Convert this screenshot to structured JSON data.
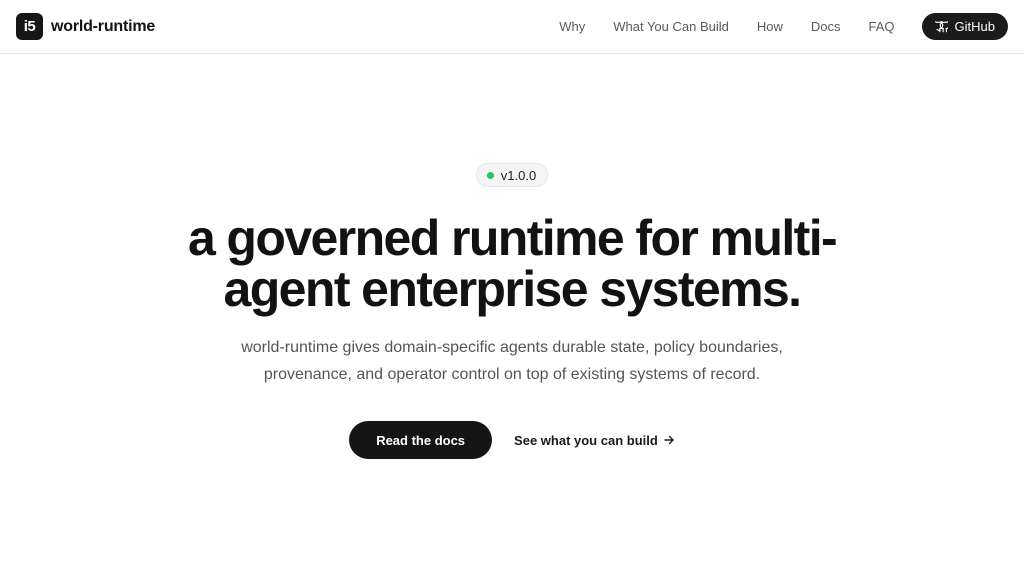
{
  "header": {
    "logo_text": "i5",
    "brand_name": "world-runtime",
    "nav": [
      {
        "label": "Why"
      },
      {
        "label": "What You Can Build"
      },
      {
        "label": "How"
      },
      {
        "label": "Docs"
      },
      {
        "label": "FAQ"
      }
    ],
    "github_label": "GitHub",
    "github_icon": "github-icon"
  },
  "hero": {
    "version_badge": "v1.0.0",
    "headline": "a governed runtime for multi-agent enterprise systems.",
    "subhead": "world-runtime gives domain-specific agents durable state, policy boundaries, provenance, and operator control on top of existing systems of record.",
    "primary_cta": "Read the docs",
    "secondary_cta": "See what you can build",
    "secondary_icon": "arrow-right-icon"
  },
  "colors": {
    "accent_dark": "#151515",
    "badge_dot": "#22c55e",
    "muted_text": "#555555",
    "nav_text": "#5a5a5a"
  }
}
